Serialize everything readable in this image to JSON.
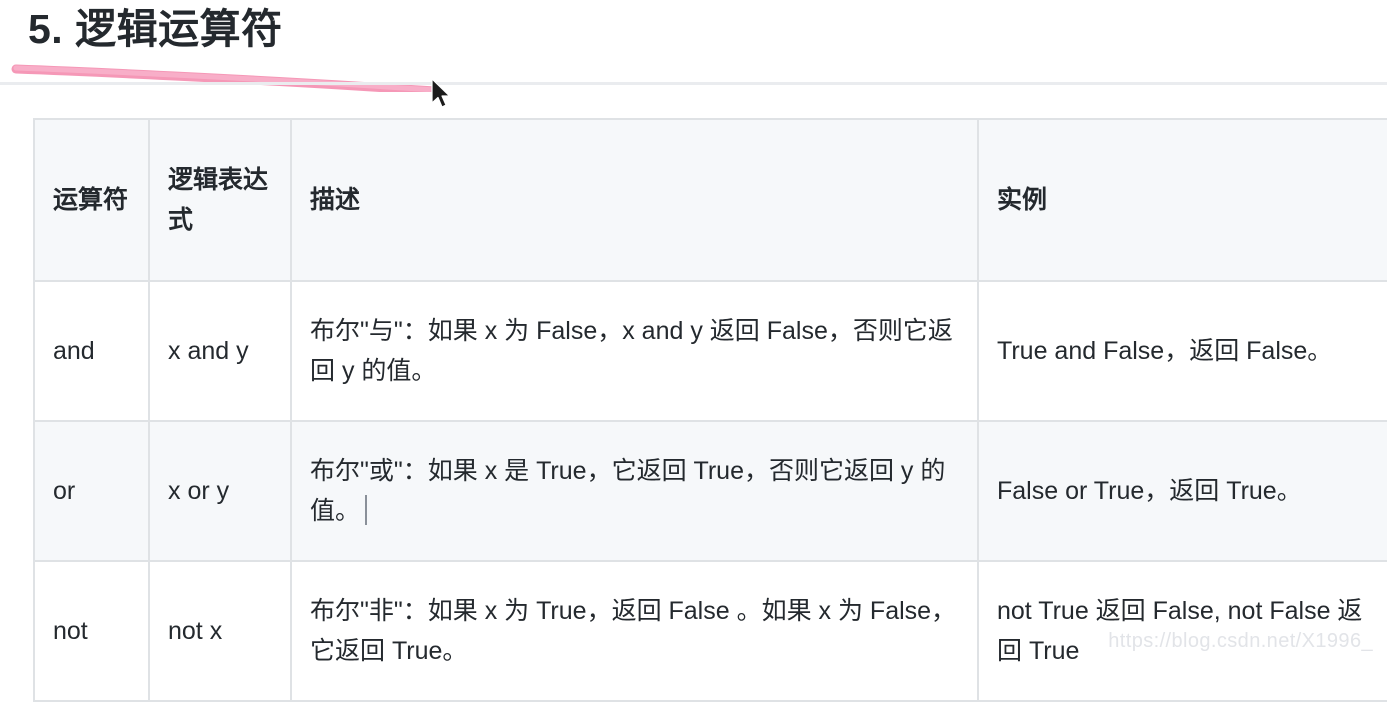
{
  "heading": {
    "text": "5. 逻辑运算符",
    "underline_color": "#f48fb1",
    "rule_color": "#eaecef"
  },
  "table": {
    "headers": [
      {
        "label": "运算符",
        "name": "operator"
      },
      {
        "label": "逻辑表达式",
        "name": "expression"
      },
      {
        "label": "描述",
        "name": "description"
      },
      {
        "label": "实例",
        "name": "example"
      }
    ],
    "rows": [
      {
        "operator": "and",
        "expression": "x and y",
        "description": "布尔\"与\"：如果 x 为 False，x and y 返回 False，否则它返回 y 的值。",
        "example": "True and False，返回 False。",
        "stripe": "white"
      },
      {
        "operator": "or",
        "expression": "x or y",
        "description": "布尔\"或\"：如果 x 是 True，它返回 True，否则它返回 y 的值。",
        "example": "False or True，返回 True。",
        "stripe": "gray",
        "has_caret": true
      },
      {
        "operator": "not",
        "expression": "not x",
        "description": "布尔\"非\"：如果 x 为 True，返回 False 。如果 x 为 False，它返回 True。",
        "example": "not True 返回 False, not False 返回 True",
        "stripe": "white"
      }
    ]
  },
  "watermark": {
    "text": "https://blog.csdn.net/X1996_"
  },
  "colors": {
    "header_bg": "#f6f8fa",
    "row_gray_bg": "#f6f8fa",
    "row_white_bg": "#ffffff",
    "border": "#dfe2e5",
    "text": "#24292e",
    "pink": "#f48fb1"
  }
}
